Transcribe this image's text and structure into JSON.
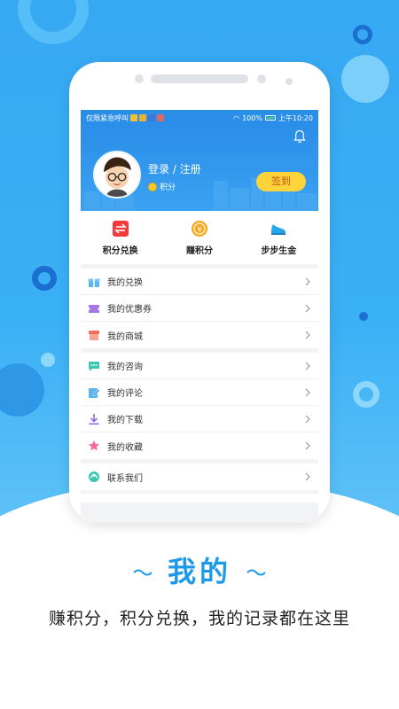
{
  "status_bar": {
    "left_text": "仅限紧急呼叫",
    "battery": "100%",
    "time": "上午10:20"
  },
  "profile": {
    "login_text": "登录 / 注册",
    "points_label": "积分",
    "signin_button": "签到"
  },
  "quick_actions": [
    {
      "label": "积分兑换",
      "icon": "exchange-icon",
      "color": "#f23b3b"
    },
    {
      "label": "赚积分",
      "icon": "coin-icon",
      "color": "#f5a623"
    },
    {
      "label": "步步生金",
      "icon": "sneaker-icon",
      "color": "#26a5e8"
    }
  ],
  "menu_group_1": [
    {
      "label": "我的兑换",
      "icon": "gift-icon"
    },
    {
      "label": "我的优惠券",
      "icon": "coupon-icon"
    },
    {
      "label": "我的商城",
      "icon": "store-icon"
    }
  ],
  "menu_group_2": [
    {
      "label": "我的咨询",
      "icon": "chat-icon"
    },
    {
      "label": "我的评论",
      "icon": "edit-icon"
    },
    {
      "label": "我的下载",
      "icon": "download-icon"
    },
    {
      "label": "我的收藏",
      "icon": "star-icon"
    }
  ],
  "menu_group_3": [
    {
      "label": "联系我们",
      "icon": "contact-icon"
    }
  ],
  "caption": {
    "title": "我的",
    "subtitle": "赚积分，积分兑换，我的记录都在这里"
  },
  "colors": {
    "brand_blue": "#2b8ee8",
    "caption_blue": "#1e98e8",
    "signin_yellow": "#ffd33a"
  }
}
